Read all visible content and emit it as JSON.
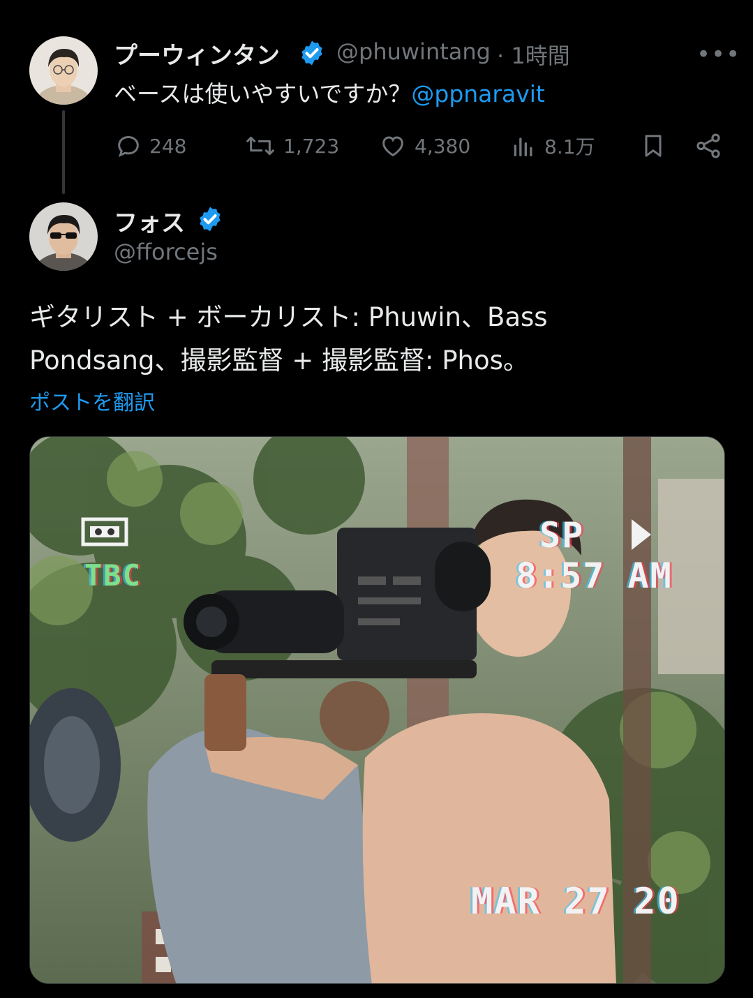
{
  "parent_post": {
    "author_name": "プーウィンタン",
    "handle": "@phuwintang",
    "time": "· 1時間",
    "text": "ベースは使いやすいですか？",
    "mention": "@ppnaravit",
    "stats": {
      "replies": "248",
      "reposts": "1,723",
      "likes": "4,380",
      "views": "8.1万"
    }
  },
  "main_post": {
    "author_name": "フォス",
    "handle": "@fforcejs",
    "text_line1": "ギタリスト + ボーカリスト: Phuwin、Bass",
    "text_line2": "Pondsang、撮影監督 + 撮影監督: Phos。",
    "translate_label": "ポストを翻訳"
  },
  "media_overlay": {
    "mode": "SP",
    "time": "8:57 AM",
    "date": "MAR 27 20",
    "tbc": "TBC"
  },
  "colors": {
    "accent": "#1d9bf0",
    "verified": "#1d9bf0",
    "muted": "#71767b",
    "text": "#e7e9ea",
    "background": "#000000"
  },
  "icons": [
    "more-icon",
    "reply-icon",
    "repost-icon",
    "like-icon",
    "views-icon",
    "bookmark-icon",
    "share-icon",
    "verified-badge-icon",
    "tape-icon",
    "play-icon"
  ]
}
